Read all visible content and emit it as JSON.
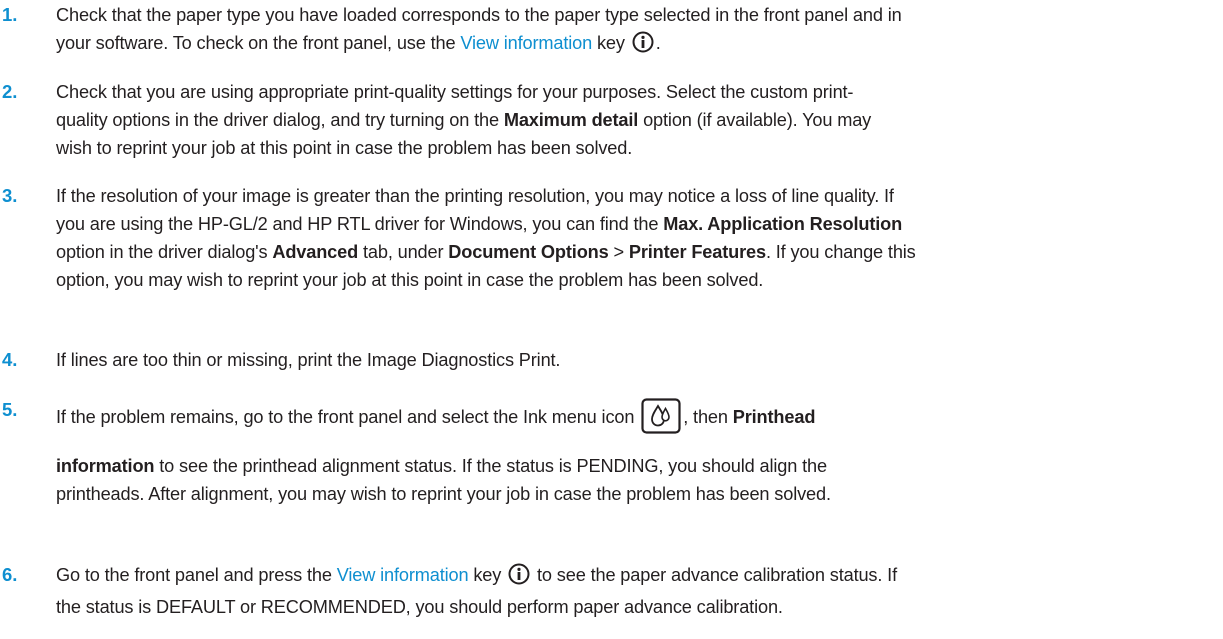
{
  "steps": [
    {
      "number": "1.",
      "line1": "Check that the paper type you have loaded corresponds to the paper type selected in the front panel and in",
      "line2_a": "your software. To check on the front panel, use the ",
      "line2_link": "View information",
      "line2_b": " key ",
      "line2_c": "."
    },
    {
      "number": "2.",
      "line1": "Check that you are using appropriate print-quality settings for your purposes. Select the custom print-",
      "line2_a": "quality options in the driver dialog, and try turning on the ",
      "line2_bold": "Maximum detail",
      "line2_b": " option (if available). You may",
      "line3": "wish to reprint your job at this point in case the problem has been solved."
    },
    {
      "number": "3.",
      "line1": "If the resolution of your image is greater than the printing resolution, you may notice a loss of line quality. If",
      "line2_a": "you are using the HP-GL/2 and HP RTL driver for Windows, you can find the ",
      "line2_bold": "Max. Application Resolution",
      "line3_a": "option in the driver dialog's ",
      "line3_bold1": "Advanced",
      "line3_b": " tab, under ",
      "line3_bold2": "Document Options",
      "line3_c": " > ",
      "line3_bold3": "Printer Features",
      "line3_d": ". If you change this",
      "line4": "option, you may wish to reprint your job at this point in case the problem has been solved."
    },
    {
      "number": "4.",
      "line1": "If lines are too thin or missing, print the Image Diagnostics Print."
    },
    {
      "number": "5.",
      "line1_a": "If the problem remains, go to the front panel and select the Ink menu icon ",
      "line1_b": ", then ",
      "line1_bold": "Printhead",
      "line2_bold": "information",
      "line2_a": " to see the printhead alignment status. If the status is PENDING, you should align the",
      "line3": "printheads. After alignment, you may wish to reprint your job in case the problem has been solved."
    },
    {
      "number": "6.",
      "line1_a": "Go to the front panel and press the ",
      "line1_link": "View information",
      "line1_b": " key ",
      "line1_c": " to see the paper advance calibration status. If",
      "line2": "the status is DEFAULT or RECOMMENDED, you should perform paper advance calibration."
    }
  ],
  "icons": {
    "info": "info-icon",
    "ink": "ink-menu-icon"
  },
  "colors": {
    "accent": "#0e8fd0",
    "text": "#231f20"
  }
}
